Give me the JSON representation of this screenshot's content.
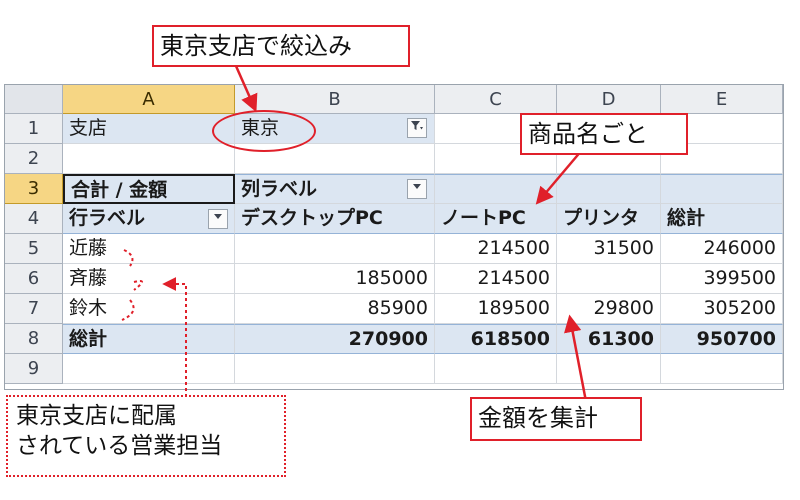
{
  "columns": [
    "A",
    "B",
    "C",
    "D",
    "E"
  ],
  "rows": [
    "1",
    "2",
    "3",
    "4",
    "5",
    "6",
    "7",
    "8",
    "9"
  ],
  "filter": {
    "label": "支店",
    "value": "東京",
    "filter_icon": "filter-dropdown-icon"
  },
  "pivot": {
    "corner_label": "合計 / 金額",
    "column_labels_field": "列ラベル",
    "row_labels_field": "行ラベル",
    "headers": [
      "デスクトップPC",
      "ノートPC",
      "プリンタ",
      "総計"
    ],
    "data_rows": [
      {
        "name": "近藤",
        "values": [
          "",
          "214500",
          "31500",
          "246000"
        ]
      },
      {
        "name": "斉藤",
        "values": [
          "185000",
          "214500",
          "",
          "399500"
        ]
      },
      {
        "name": "鈴木",
        "values": [
          "85900",
          "189500",
          "29800",
          "305200"
        ]
      }
    ],
    "total": {
      "name": "総計",
      "values": [
        "270900",
        "618500",
        "61300",
        "950700"
      ]
    }
  },
  "annotations": {
    "filter_callout": "東京支店で絞込み",
    "product_callout": "商品名ごと",
    "amount_callout": "金額を集計",
    "staff_callout_line1": "東京支店に配属",
    "staff_callout_line2": "されている営業担当"
  },
  "colors": {
    "annotation_red": "#e0202a",
    "pivot_band": "#dce6f2",
    "selected_header": "#f6d684"
  }
}
